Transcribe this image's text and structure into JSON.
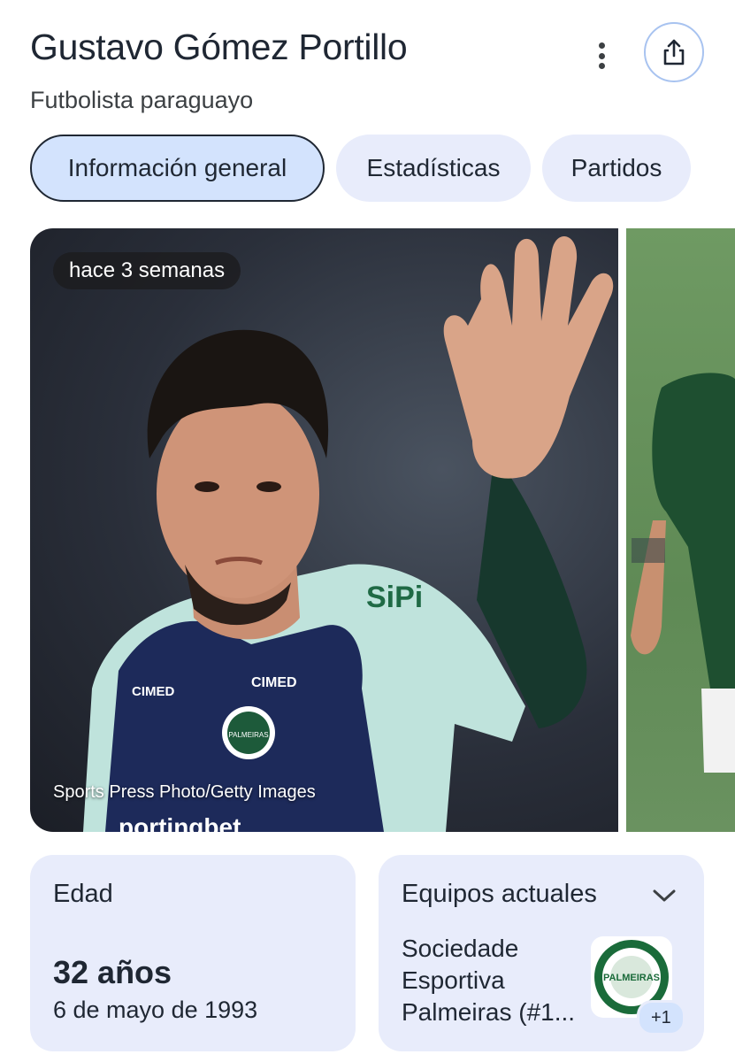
{
  "header": {
    "title": "Gustavo Gómez Portillo",
    "subtitle": "Futbolista paraguayo"
  },
  "tabs": [
    {
      "label": "Información general",
      "active": true
    },
    {
      "label": "Estadísticas",
      "active": false
    },
    {
      "label": "Partidos",
      "active": false
    }
  ],
  "photo": {
    "time_badge": "hace 3 semanas",
    "credit": "Sports Press Photo/Getty Images",
    "jersey_text_1": "CIMED",
    "jersey_text_2": "CIMED",
    "jersey_text_3": "SiPi",
    "jersey_text_4": "portingbet",
    "crest_text": "PALMEIRAS"
  },
  "age_card": {
    "label": "Edad",
    "value": "32 años",
    "birthdate": "6 de mayo de 1993"
  },
  "teams_card": {
    "label": "Equipos actuales",
    "team_name": "Sociedade Esportiva Palmeiras (#1...",
    "logo_text": "PALMEIRAS",
    "extra_count": "+1"
  },
  "colors": {
    "chip_bg": "#e8ecfb",
    "chip_active_bg": "#d3e3fd",
    "text_dark": "#1f2733",
    "share_border": "#a8c3f0"
  }
}
